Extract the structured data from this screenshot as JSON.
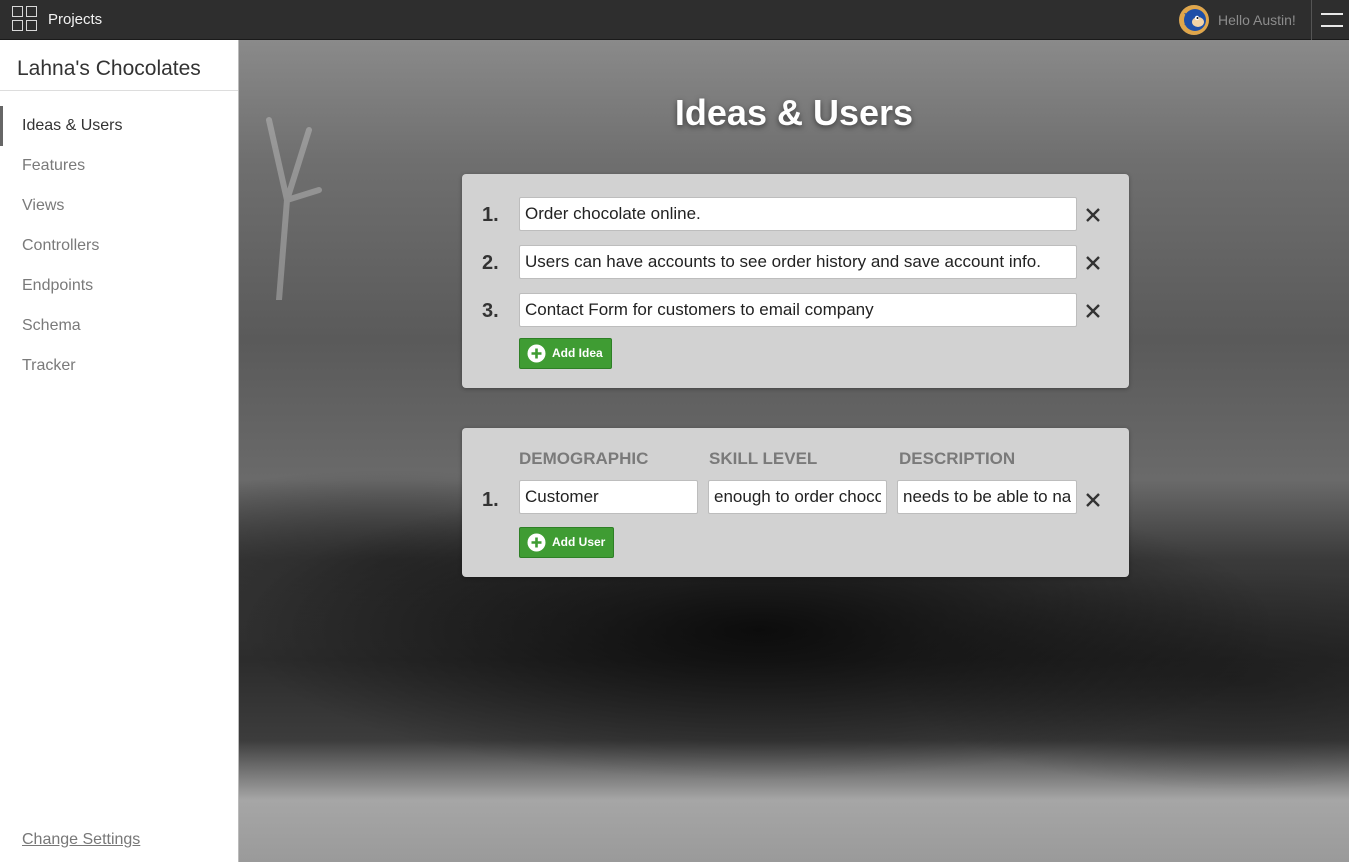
{
  "topbar": {
    "projects_label": "Projects",
    "greeting": "Hello Austin!"
  },
  "sidebar": {
    "project_name": "Lahna's Chocolates",
    "items": [
      {
        "label": "Ideas & Users",
        "active": true
      },
      {
        "label": "Features",
        "active": false
      },
      {
        "label": "Views",
        "active": false
      },
      {
        "label": "Controllers",
        "active": false
      },
      {
        "label": "Endpoints",
        "active": false
      },
      {
        "label": "Schema",
        "active": false
      },
      {
        "label": "Tracker",
        "active": false
      }
    ],
    "change_settings": "Change Settings"
  },
  "main": {
    "title": "Ideas & Users",
    "ideas": [
      {
        "number": "1.",
        "value": "Order chocolate online."
      },
      {
        "number": "2.",
        "value": "Users can have accounts to see order history and save account info."
      },
      {
        "number": "3.",
        "value": "Contact Form for customers to email company"
      }
    ],
    "add_idea_label": "Add Idea",
    "user_columns": [
      "DEMOGRAPHIC",
      "SKILL LEVEL",
      "DESCRIPTION"
    ],
    "users": [
      {
        "number": "1.",
        "demographic": "Customer",
        "skill_level": "enough to order chocolate",
        "description": "needs to be able to navigate"
      }
    ],
    "add_user_label": "Add User"
  },
  "colors": {
    "accent_green": "#3f9c33",
    "topbar_bg": "#2e2e2e",
    "card_bg": "#d2d2d2"
  },
  "icons": [
    "grid-icon",
    "avatar",
    "hamburger-menu-icon",
    "close-icon",
    "plus-circle-icon"
  ]
}
